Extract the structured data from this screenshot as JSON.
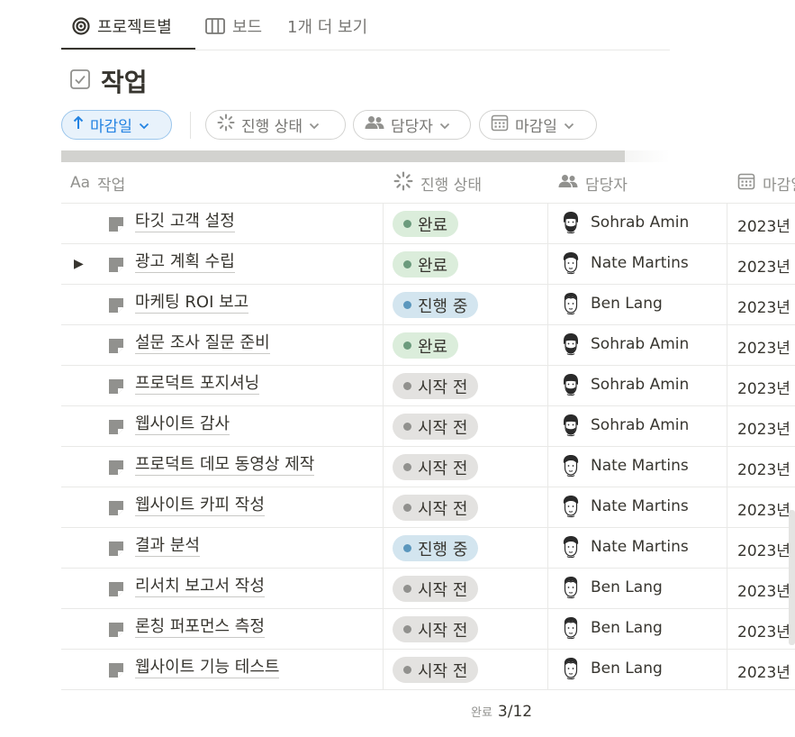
{
  "tabs": [
    {
      "label": "프로젝트별",
      "icon": "target-icon",
      "active": true
    },
    {
      "label": "보드",
      "icon": "board-icon",
      "active": false
    },
    {
      "label": "1개 더 보기",
      "icon": "",
      "active": false
    }
  ],
  "title": {
    "icon": "checkbox-icon",
    "text": "작업"
  },
  "filters": {
    "sort": {
      "icon": "arrow-up-icon",
      "label": "마감일"
    },
    "chips": [
      {
        "icon": "status-spinner-icon",
        "label": "진행 상태"
      },
      {
        "icon": "people-icon",
        "label": "담당자"
      },
      {
        "icon": "calendar-icon",
        "label": "마감일"
      }
    ]
  },
  "columns": {
    "task": {
      "icon": "text-type-icon",
      "icon_text": "Aa",
      "label": "작업"
    },
    "status": {
      "icon": "status-spinner-icon",
      "label": "진행 상태"
    },
    "assignee": {
      "icon": "people-icon",
      "label": "담당자"
    },
    "due": {
      "icon": "calendar-icon",
      "label": "마감일"
    }
  },
  "status_colors": {
    "완료": {
      "bg": "#dbeddb",
      "dot": "#6c9b7d"
    },
    "진행 중": {
      "bg": "#d3e5ef",
      "dot": "#5b97bd"
    },
    "시작 전": {
      "bg": "#e3e2e0",
      "dot": "#91918e"
    }
  },
  "rows": [
    {
      "task": "타깃 고객 설정",
      "has_toggle": false,
      "status": "완료",
      "assignee": "Sohrab Amin",
      "due": "2023년"
    },
    {
      "task": "광고 계획 수립",
      "has_toggle": true,
      "status": "완료",
      "assignee": "Nate Martins",
      "due": "2023년"
    },
    {
      "task": "마케팅 ROI 보고",
      "has_toggle": false,
      "status": "진행 중",
      "assignee": "Ben Lang",
      "due": "2023년"
    },
    {
      "task": "설문 조사 질문 준비",
      "has_toggle": false,
      "status": "완료",
      "assignee": "Sohrab Amin",
      "due": "2023년"
    },
    {
      "task": "프로덕트 포지셔닝",
      "has_toggle": false,
      "status": "시작 전",
      "assignee": "Sohrab Amin",
      "due": "2023년"
    },
    {
      "task": "웹사이트 감사",
      "has_toggle": false,
      "status": "시작 전",
      "assignee": "Sohrab Amin",
      "due": "2023년"
    },
    {
      "task": "프로덕트 데모 동영상 제작",
      "has_toggle": false,
      "status": "시작 전",
      "assignee": "Nate Martins",
      "due": "2023년"
    },
    {
      "task": "웹사이트 카피 작성",
      "has_toggle": false,
      "status": "시작 전",
      "assignee": "Nate Martins",
      "due": "2023년"
    },
    {
      "task": "결과 분석",
      "has_toggle": false,
      "status": "진행 중",
      "assignee": "Nate Martins",
      "due": "2023년"
    },
    {
      "task": "리서치 보고서 작성",
      "has_toggle": false,
      "status": "시작 전",
      "assignee": "Ben Lang",
      "due": "2023년"
    },
    {
      "task": "론칭 퍼포먼스 측정",
      "has_toggle": false,
      "status": "시작 전",
      "assignee": "Ben Lang",
      "due": "2023년"
    },
    {
      "task": "웹사이트 기능 테스트",
      "has_toggle": false,
      "status": "시작 전",
      "assignee": "Ben Lang",
      "due": "2023년"
    }
  ],
  "footer": {
    "label": "완료",
    "value": "3/12"
  }
}
